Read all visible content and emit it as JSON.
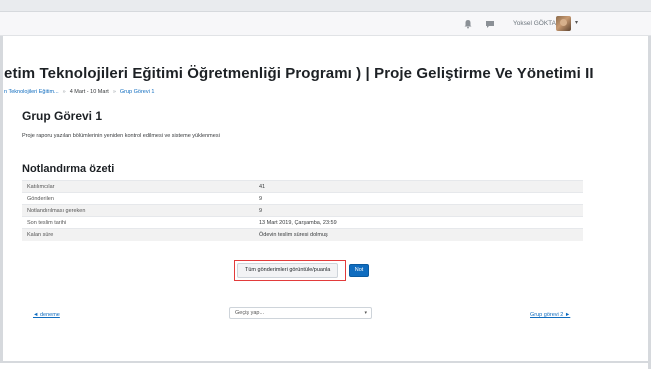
{
  "navbar": {
    "user_name": "Yoksel GÖKTAŞ",
    "caret": "▾"
  },
  "course": {
    "title": "etim Teknolojileri Eğitimi Öğretmenliği Programı ) | Proje Geliştirme Ve Yönetimi II"
  },
  "breadcrumb": {
    "items": [
      "n Teknolojileri Eğitim...",
      "4 Mart - 10 Mart",
      "Grup Görevi 1"
    ],
    "separator": "»"
  },
  "assignment": {
    "title": "Grup Görevi 1",
    "description": "Proje raporu yazılan bölümlerinin yeniden kontrol edilmesi ve sisteme yüklenmesi"
  },
  "grading_summary": {
    "heading": "Notlandırma özeti",
    "rows": [
      {
        "label": "Katılımcılar",
        "value": "41"
      },
      {
        "label": "Gönderilen",
        "value": "9"
      },
      {
        "label": "Notlandırılması gereken",
        "value": "9"
      },
      {
        "label": "Son teslim tarihi",
        "value": "13 Mart 2019, Çarşamba, 23:59"
      },
      {
        "label": "Kalan süre",
        "value": "Ödevin teslim süresi dolmuş"
      }
    ]
  },
  "actions": {
    "view_all_label": "Tüm gönderimleri görüntüle/puanla",
    "grade_label": "Not"
  },
  "nav": {
    "prev_label": "◄ deneme",
    "jump_placeholder": "Geçiş yap...",
    "jump_arrow": "▾",
    "next_label": "Grup görevi 2 ►"
  },
  "colors": {
    "accent": "#0f6cbf",
    "highlight": "#e23b3b"
  }
}
